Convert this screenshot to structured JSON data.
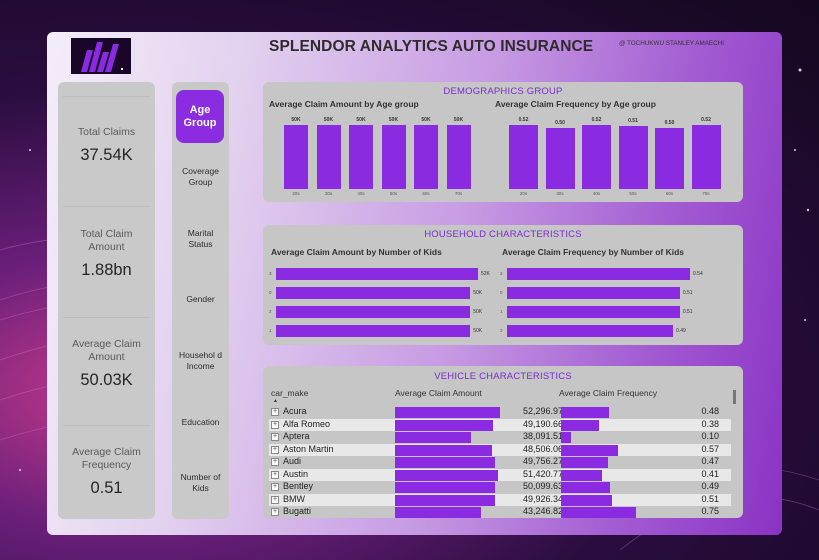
{
  "header": {
    "title": "SPLENDOR ANALYTICS AUTO INSURANCE",
    "credit": "@ TOCHUKWU STANLEY AMAECHI"
  },
  "kpis": [
    {
      "label": "Total Claims",
      "value": "37.54K"
    },
    {
      "label": "Total Claim Amount",
      "value": "1.88bn"
    },
    {
      "label": "Average Claim Amount",
      "value": "50.03K"
    },
    {
      "label": "Average Claim Frequency",
      "value": "0.51"
    }
  ],
  "nav": {
    "items": [
      {
        "label": "Age Group",
        "active": true
      },
      {
        "label": "Coverage Group"
      },
      {
        "label": "Marital Status"
      },
      {
        "label": "Gender"
      },
      {
        "label": "Househol d Income"
      },
      {
        "label": "Education"
      },
      {
        "label": "Number of Kids"
      }
    ]
  },
  "demographics": {
    "title": "DEMOGRAPHICS GROUP",
    "amount_title": "Average Claim Amount by Age group",
    "frequency_title": "Average Claim Frequency by Age group"
  },
  "household": {
    "title": "HOUSEHOLD CHARACTERISTICS",
    "amount_title": "Average Claim Amount by Number of Kids",
    "frequency_title": "Average Claim Frequency by Number of Kids"
  },
  "vehicle": {
    "title": "VEHICLE CHARACTERISTICS",
    "col_make": "car_make",
    "col_amount": "Average Claim Amount",
    "col_frequency": "Average Claim Frequency",
    "rows": [
      {
        "make": "Acura",
        "amount": "52,296.97",
        "amount_value": 52296.97,
        "frequency": "0.48",
        "frequency_value": 0.48
      },
      {
        "make": "Alfa Romeo",
        "amount": "49,190.66",
        "amount_value": 49190.66,
        "frequency": "0.38",
        "frequency_value": 0.38
      },
      {
        "make": "Aptera",
        "amount": "38,091.51",
        "amount_value": 38091.51,
        "frequency": "0.10",
        "frequency_value": 0.1
      },
      {
        "make": "Aston Martin",
        "amount": "48,506.06",
        "amount_value": 48506.06,
        "frequency": "0.57",
        "frequency_value": 0.57
      },
      {
        "make": "Audi",
        "amount": "49,756.27",
        "amount_value": 49756.27,
        "frequency": "0.47",
        "frequency_value": 0.47
      },
      {
        "make": "Austin",
        "amount": "51,420.77",
        "amount_value": 51420.77,
        "frequency": "0.41",
        "frequency_value": 0.41
      },
      {
        "make": "Bentley",
        "amount": "50,099.63",
        "amount_value": 50099.63,
        "frequency": "0.49",
        "frequency_value": 0.49
      },
      {
        "make": "BMW",
        "amount": "49,926.34",
        "amount_value": 49926.34,
        "frequency": "0.51",
        "frequency_value": 0.51
      },
      {
        "make": "Bugatti",
        "amount": "43,246.82",
        "amount_value": 43246.82,
        "frequency": "0.75",
        "frequency_value": 0.75
      }
    ]
  },
  "chart_data": [
    {
      "type": "bar",
      "title": "Average Claim Amount by Age group",
      "categories": [
        "20s",
        "30s",
        "40s",
        "50s",
        "60s",
        "70s"
      ],
      "values": [
        50000,
        50000,
        50000,
        50000,
        50000,
        50000
      ],
      "data_labels": [
        "50K",
        "50K",
        "50K",
        "50K",
        "50K",
        "50K"
      ],
      "color": "#8a2be2"
    },
    {
      "type": "bar",
      "title": "Average Claim Frequency by Age group",
      "categories": [
        "20s",
        "30s",
        "40s",
        "50s",
        "60s",
        "70s"
      ],
      "values": [
        0.52,
        0.5,
        0.52,
        0.51,
        0.5,
        0.52
      ],
      "data_labels": [
        "0.52",
        "0.50",
        "0.52",
        "0.51",
        "0.50",
        "0.52"
      ],
      "color": "#8a2be2"
    },
    {
      "type": "bar",
      "orientation": "horizontal",
      "title": "Average Claim Amount by Number of Kids",
      "categories": [
        "3",
        "0",
        "2",
        "1"
      ],
      "values": [
        52000,
        50000,
        50000,
        50000
      ],
      "data_labels": [
        "52K",
        "50K",
        "50K",
        "50K"
      ],
      "color": "#8a2be2"
    },
    {
      "type": "bar",
      "orientation": "horizontal",
      "title": "Average Claim Frequency by Number of Kids",
      "categories": [
        "3",
        "0",
        "1",
        "2"
      ],
      "values": [
        0.54,
        0.51,
        0.51,
        0.49
      ],
      "data_labels": [
        "0.54",
        "0.51",
        "0.51",
        "0.49"
      ],
      "color": "#8a2be2"
    }
  ]
}
